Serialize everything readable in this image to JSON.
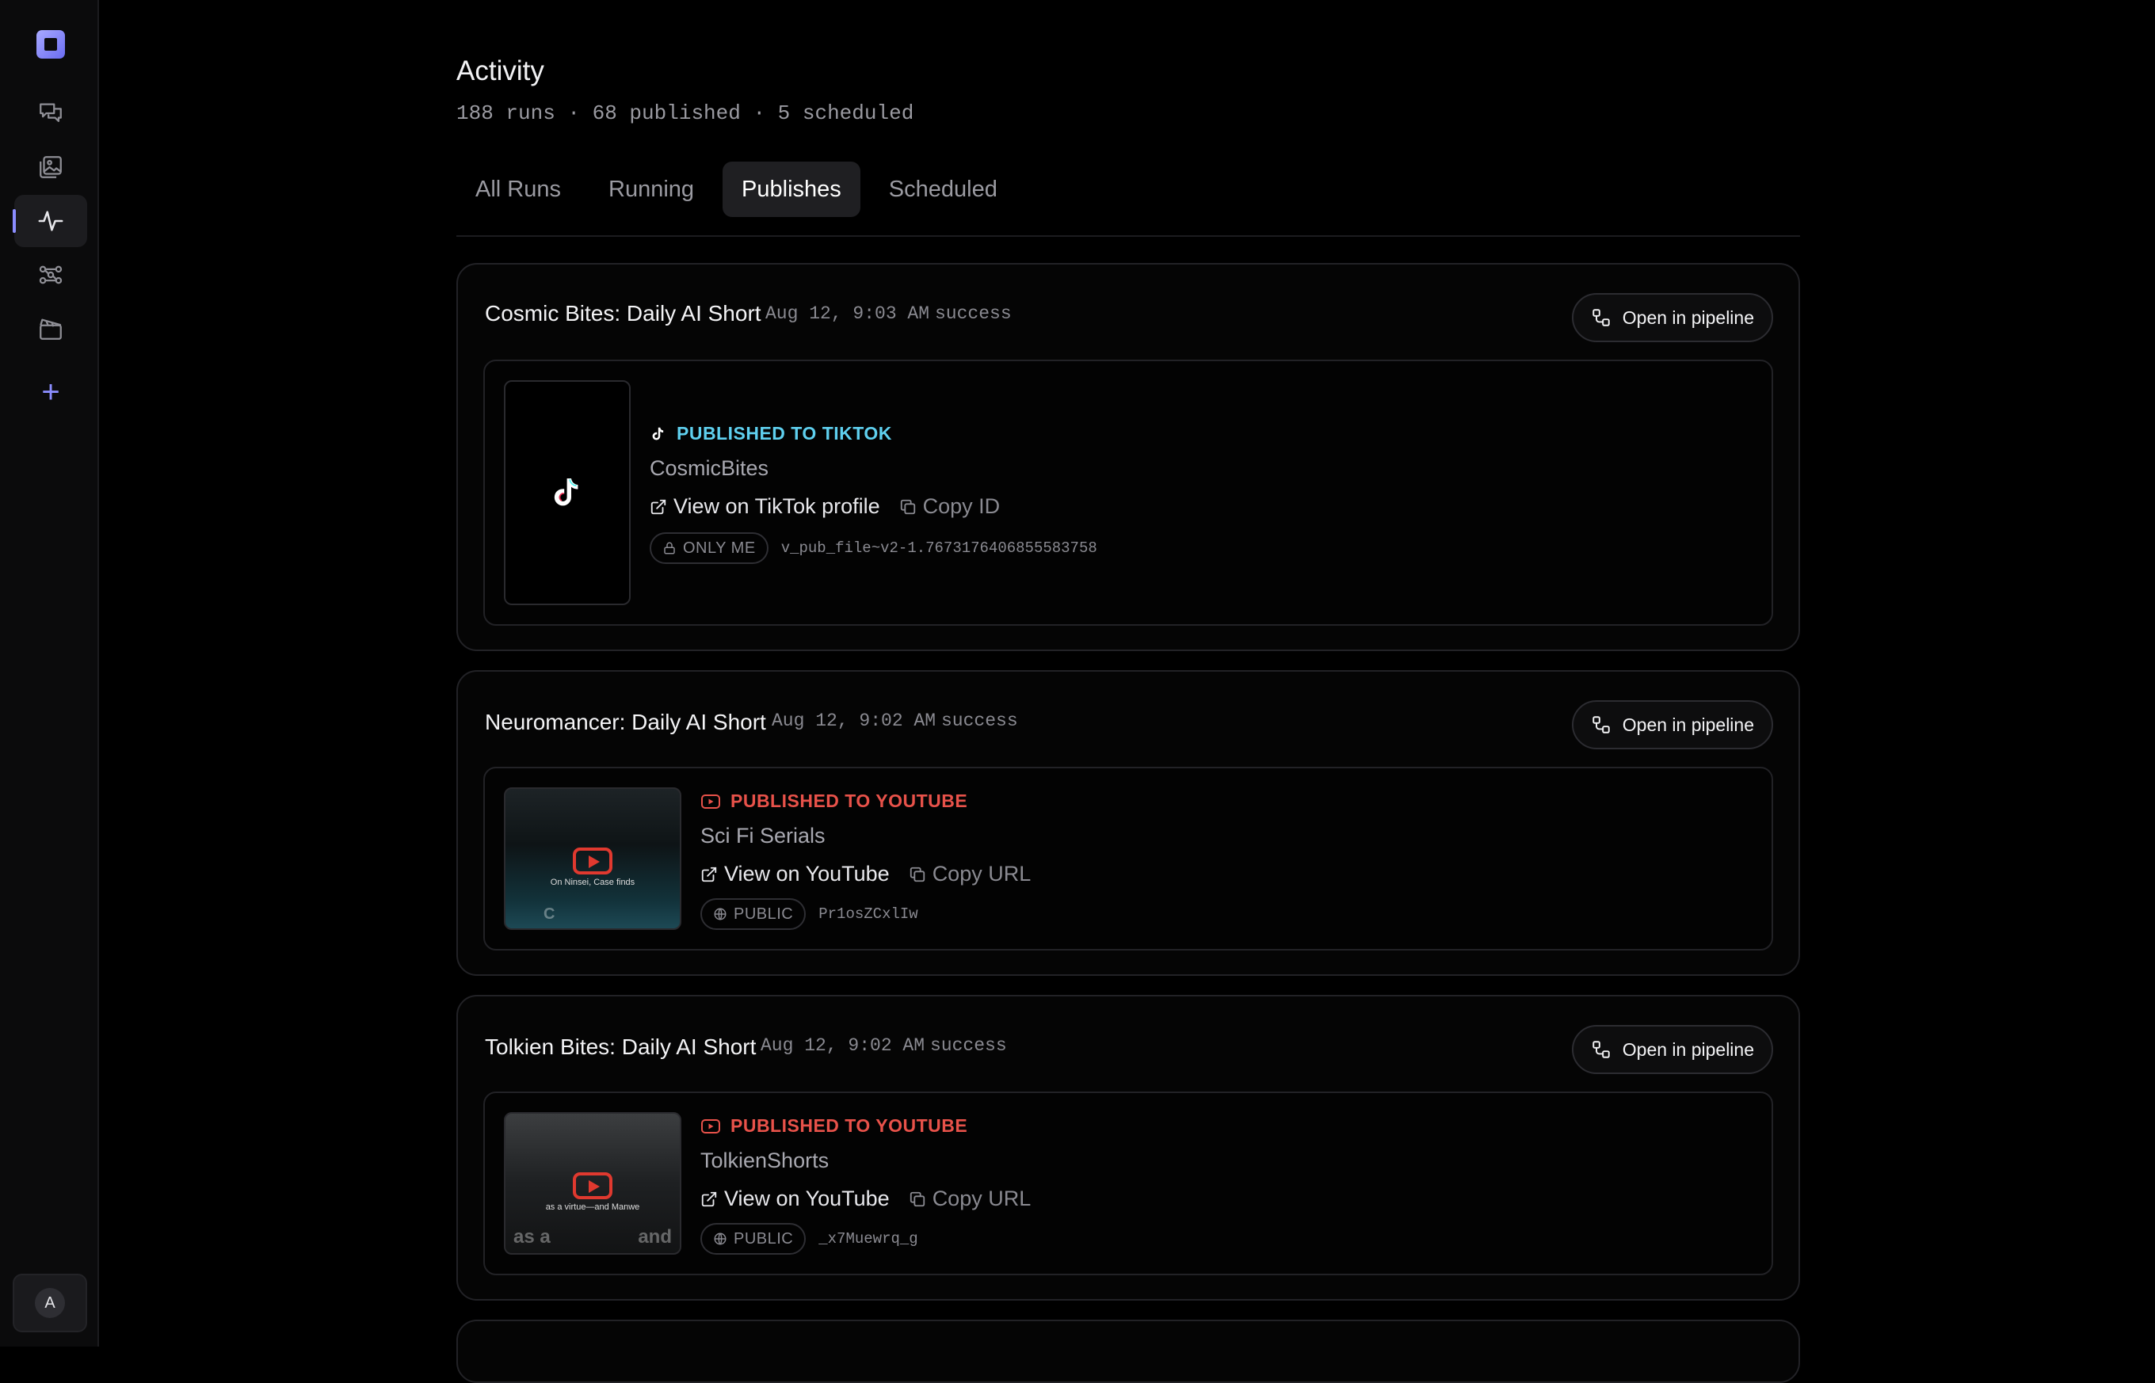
{
  "sidebar": {
    "items": [
      {
        "name": "chat-icon"
      },
      {
        "name": "gallery-icon"
      },
      {
        "name": "activity-icon",
        "active": true
      },
      {
        "name": "pipeline-icon"
      },
      {
        "name": "clapperboard-icon"
      },
      {
        "name": "plus-icon"
      }
    ],
    "user_initial": "A"
  },
  "header": {
    "title": "Activity",
    "subtitle": "188 runs · 68 published · 5 scheduled"
  },
  "tabs": [
    {
      "label": "All Runs",
      "active": false
    },
    {
      "label": "Running",
      "active": false
    },
    {
      "label": "Publishes",
      "active": true
    },
    {
      "label": "Scheduled",
      "active": false
    }
  ],
  "cards": [
    {
      "title": "Cosmic Bites: Daily AI Short",
      "date": "Aug 12, 9:03 AM",
      "status": "success",
      "pipeline_label": "Open in pipeline",
      "platform_label": "PUBLISHED TO TIKTOK",
      "channel": "CosmicBites",
      "view_label": "View on TikTok profile",
      "copy_label": "Copy ID",
      "visibility": "ONLY ME",
      "id": "v_pub_file~v2-1.7673176406855583758"
    },
    {
      "title": "Neuromancer: Daily AI Short",
      "date": "Aug 12, 9:02 AM",
      "status": "success",
      "pipeline_label": "Open in pipeline",
      "platform_label": "PUBLISHED TO YOUTUBE",
      "channel": "Sci Fi Serials",
      "view_label": "View on YouTube",
      "copy_label": "Copy URL",
      "visibility": "PUBLIC",
      "id": "Pr1osZCxlIw",
      "thumb_caption": "On Ninsei, Case finds",
      "thumb_edge_left": "C"
    },
    {
      "title": "Tolkien Bites: Daily AI Short",
      "date": "Aug 12, 9:02 AM",
      "status": "success",
      "pipeline_label": "Open in pipeline",
      "platform_label": "PUBLISHED TO YOUTUBE",
      "channel": "TolkienShorts",
      "view_label": "View on YouTube",
      "copy_label": "Copy URL",
      "visibility": "PUBLIC",
      "id": "_x7Muewrq_g",
      "thumb_caption": "as a virtue—and Manwe",
      "thumb_edge_left": "as a",
      "thumb_edge_right": "and"
    }
  ],
  "colors": {
    "accent": "#8b8dff",
    "tiktok": "#5fd0ef",
    "youtube": "#e8524a"
  }
}
